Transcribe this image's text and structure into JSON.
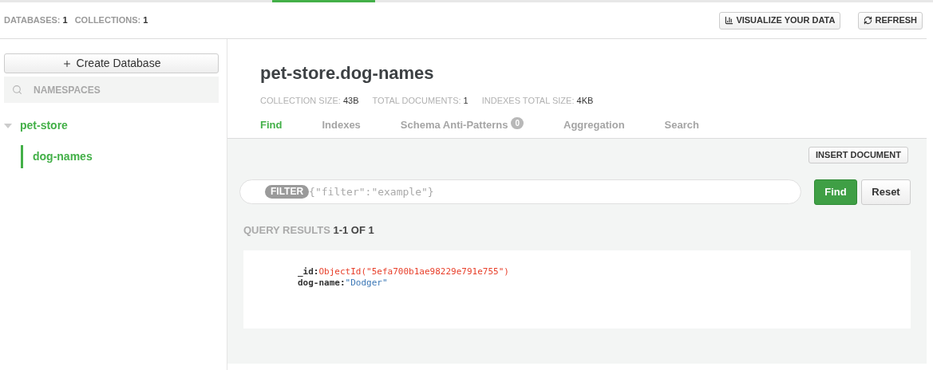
{
  "header": {
    "stats": [
      {
        "label": "DATABASES:",
        "value": "1"
      },
      {
        "label": "COLLECTIONS:",
        "value": "1"
      }
    ],
    "buttons": [
      {
        "kind": "chart",
        "label": "VISUALIZE YOUR DATA"
      },
      {
        "kind": "refresh",
        "label": "REFRESH"
      }
    ]
  },
  "sidebar": {
    "create_button": "Create Database",
    "search": {
      "placeholder": "NAMESPACES"
    },
    "tree": [
      {
        "label": "pet-store",
        "expanded": true,
        "children": [
          {
            "label": "dog-names",
            "selected": true
          }
        ]
      }
    ]
  },
  "collection": {
    "title": "pet-store.dog-names",
    "stats": [
      {
        "label": "COLLECTION SIZE:",
        "value": "43B"
      },
      {
        "label": "TOTAL DOCUMENTS:",
        "value": "1"
      },
      {
        "label": "INDEXES TOTAL SIZE:",
        "value": "4KB"
      }
    ],
    "tabs": [
      {
        "label": "Find",
        "selected": true
      },
      {
        "label": "Indexes",
        "selected": false
      },
      {
        "label": "Schema Anti-Patterns",
        "selected": false,
        "badge": "0"
      },
      {
        "label": "Aggregation",
        "selected": false
      },
      {
        "label": "Search",
        "selected": false
      }
    ]
  },
  "toolbar": {
    "insert_button": "INSERT DOCUMENT",
    "filter_tag": "FILTER",
    "filter": {
      "placeholder": "{\"filter\":\"example\"}"
    },
    "find_button": "Find",
    "reset_button": "Reset"
  },
  "results": {
    "label": "QUERY RESULTS",
    "range": "1-1 OF 1"
  },
  "documents": [
    {
      "fields": [
        {
          "key": "_id:",
          "value": "ObjectId(\"5efa700b1ae98229e791e755\")",
          "kind": "objectid"
        },
        {
          "key": "dog-name:",
          "value": "\"Dodger\"",
          "kind": "string"
        }
      ]
    }
  ]
}
